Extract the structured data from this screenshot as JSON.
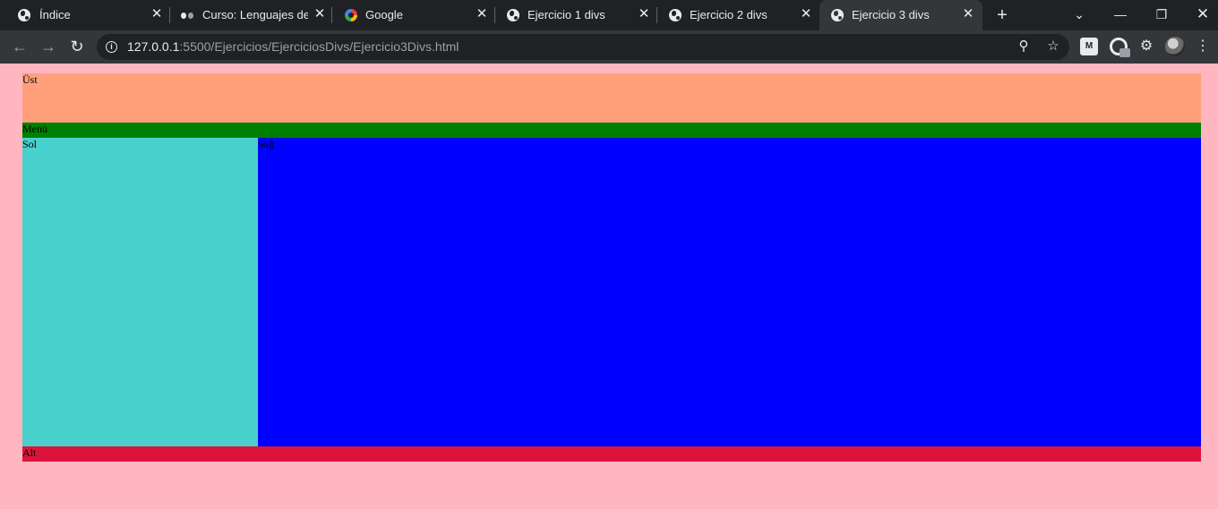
{
  "browser": {
    "tabs": [
      {
        "title": "Índice",
        "icon": "globe-icon"
      },
      {
        "title": "Curso: Lenguajes de M",
        "icon": "dots-icon"
      },
      {
        "title": "Google",
        "icon": "google-icon"
      },
      {
        "title": "Ejercicio 1 divs",
        "icon": "globe-icon"
      },
      {
        "title": "Ejercicio 2 divs",
        "icon": "globe-icon"
      },
      {
        "title": "Ejercicio 3 divs",
        "icon": "globe-icon",
        "active": true
      }
    ],
    "address": {
      "host": "127.0.0.1",
      "path": ":5500/Ejercicios/EjerciciosDivs/Ejercicio3Divs.html"
    }
  },
  "page": {
    "ust": "Üst",
    "menu": "Menü",
    "sol": "Sol",
    "sag": "Sağ",
    "alt": "Alt"
  },
  "colors": {
    "background": "#ffb6c1",
    "ust": "#ffa07a",
    "menu": "#008000",
    "sol": "#48d1cc",
    "sag": "#0000ff",
    "alt": "#dc143c"
  }
}
